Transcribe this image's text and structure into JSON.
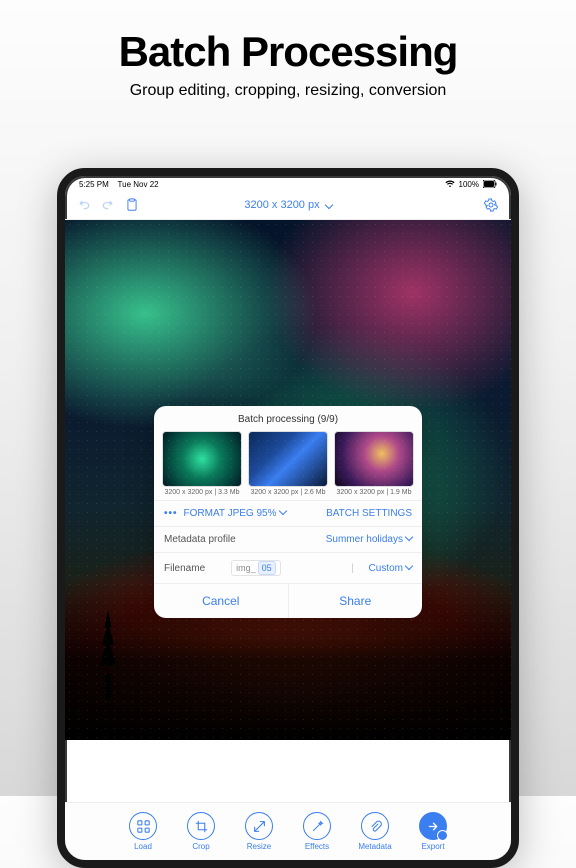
{
  "promo": {
    "title": "Batch Processing",
    "subtitle": "Group editing, cropping, resizing, conversion"
  },
  "status": {
    "time": "5:25 PM",
    "date": "Tue Nov 22",
    "battery": "100%"
  },
  "toolbar": {
    "size_label": "3200 x 3200 px"
  },
  "modal": {
    "title": "Batch processing (9/9)",
    "thumbs": [
      {
        "caption": "3200 x 3200 px | 3.3 Mb"
      },
      {
        "caption": "3200 x 3200 px | 2.6 Mb"
      },
      {
        "caption": "3200 x 3200 px | 1.9 Mb"
      }
    ],
    "format_label": "FORMAT JPEG 95%",
    "batch_settings_label": "BATCH SETTINGS",
    "metadata_label": "Metadata profile",
    "metadata_value": "Summer holidays",
    "filename_label": "Filename",
    "filename_prefix": "img_",
    "filename_seq": "05",
    "filename_mode": "Custom",
    "cancel": "Cancel",
    "share": "Share"
  },
  "tabs": {
    "load": "Load",
    "crop": "Crop",
    "resize": "Resize",
    "effects": "Effects",
    "metadata": "Metadata",
    "export": "Export"
  }
}
